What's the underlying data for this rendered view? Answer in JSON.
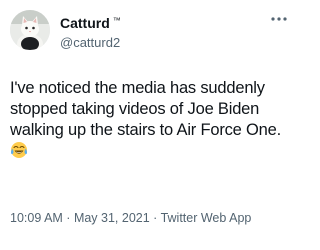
{
  "tweet": {
    "author": {
      "display_name": "Catturd",
      "trademark": "™",
      "handle": "@catturd2",
      "avatar_icon": "cat-avatar-icon"
    },
    "more_icon": "more-dots-icon",
    "text_lines": [
      "I've noticed the media has suddenly",
      "stopped taking videos of Joe Biden",
      "walking up the stairs to Air Force One."
    ],
    "emoji": "face-with-tears-of-joy-icon",
    "time": "10:09 AM",
    "date": "May 31, 2021",
    "separator": " · ",
    "source": "Twitter Web App"
  }
}
